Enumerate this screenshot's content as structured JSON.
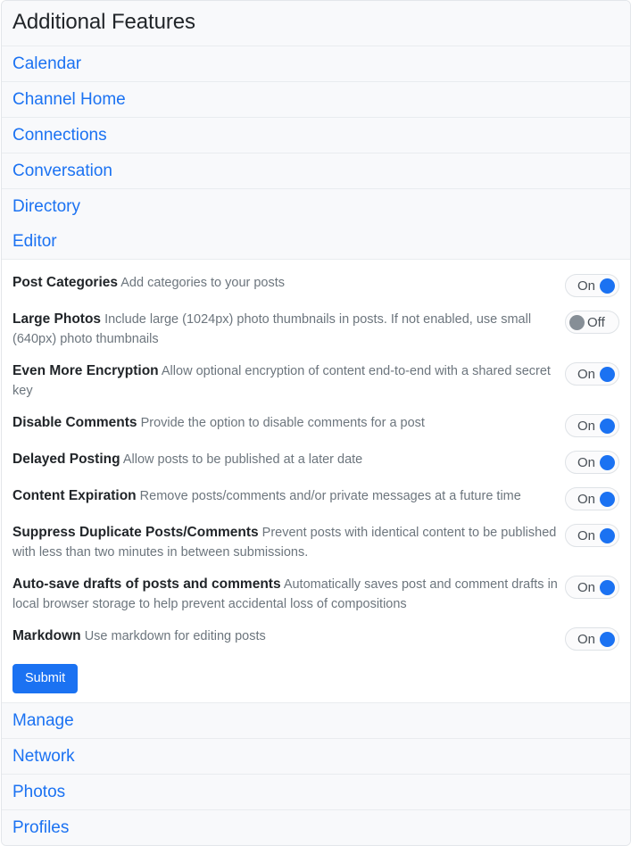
{
  "header": {
    "title": "Additional Features"
  },
  "colors": {
    "link": "#1b72f2",
    "toggle_on": "#1b72f2",
    "toggle_off": "#868e96",
    "button": "#1b72f2",
    "row_bg": "#f8f9fb",
    "border": "#e9ecef"
  },
  "sections_before": [
    {
      "label": "Calendar"
    },
    {
      "label": "Channel Home"
    },
    {
      "label": "Connections"
    },
    {
      "label": "Conversation"
    },
    {
      "label": "Directory"
    }
  ],
  "expanded_section": {
    "label": "Editor",
    "features": [
      {
        "label": "Post Categories",
        "desc": "Add categories to your posts",
        "toggle": {
          "state": "on",
          "label": "On"
        }
      },
      {
        "label": "Large Photos",
        "desc": "Include large (1024px) photo thumbnails in posts. If not enabled, use small (640px) photo thumbnails",
        "toggle": {
          "state": "off",
          "label": "Off"
        }
      },
      {
        "label": "Even More Encryption",
        "desc": "Allow optional encryption of content end-to-end with a shared secret key",
        "toggle": {
          "state": "on",
          "label": "On"
        }
      },
      {
        "label": "Disable Comments",
        "desc": "Provide the option to disable comments for a post",
        "toggle": {
          "state": "on",
          "label": "On"
        }
      },
      {
        "label": "Delayed Posting",
        "desc": "Allow posts to be published at a later date",
        "toggle": {
          "state": "on",
          "label": "On"
        }
      },
      {
        "label": "Content Expiration",
        "desc": "Remove posts/comments and/or private messages at a future time",
        "toggle": {
          "state": "on",
          "label": "On"
        }
      },
      {
        "label": "Suppress Duplicate Posts/Comments",
        "desc": "Prevent posts with identical content to be published with less than two minutes in between submissions.",
        "toggle": {
          "state": "on",
          "label": "On"
        }
      },
      {
        "label": "Auto-save drafts of posts and comments",
        "desc": "Automatically saves post and comment drafts in local browser storage to help prevent accidental loss of compositions",
        "toggle": {
          "state": "on",
          "label": "On"
        }
      },
      {
        "label": "Markdown",
        "desc": "Use markdown for editing posts",
        "toggle": {
          "state": "on",
          "label": "On"
        }
      }
    ],
    "submit_label": "Submit"
  },
  "sections_after": [
    {
      "label": "Manage"
    },
    {
      "label": "Network"
    },
    {
      "label": "Photos"
    },
    {
      "label": "Profiles"
    }
  ]
}
